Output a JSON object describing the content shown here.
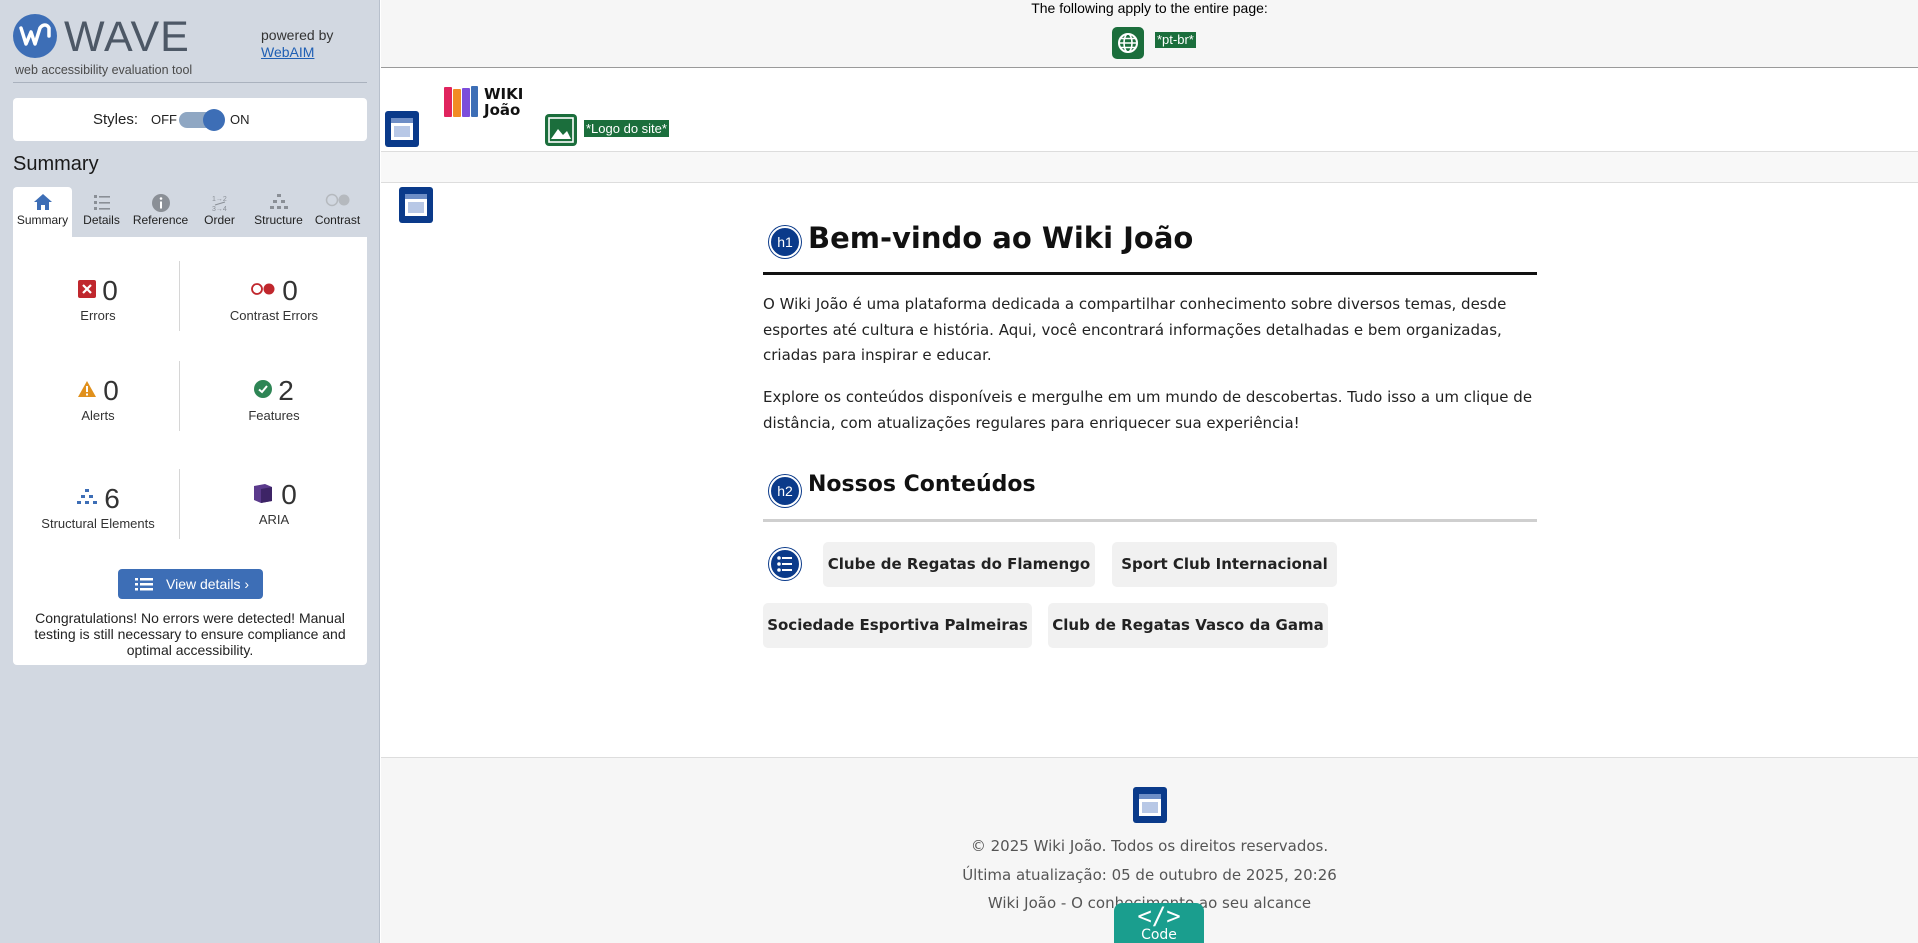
{
  "wave": {
    "title": "WAVE",
    "subtitle": "web accessibility evaluation tool",
    "powered_by": "powered by",
    "webaim_link": "WebAIM",
    "styles_label": "Styles:",
    "styles_off": "OFF",
    "styles_on": "ON",
    "styles_enabled": true,
    "summary_heading": "Summary",
    "tabs": [
      {
        "label": "Summary",
        "icon": "home-icon",
        "active": true
      },
      {
        "label": "Details",
        "icon": "list-icon",
        "active": false
      },
      {
        "label": "Reference",
        "icon": "info-icon",
        "active": false
      },
      {
        "label": "Order",
        "icon": "order-icon",
        "active": false
      },
      {
        "label": "Structure",
        "icon": "structure-icon",
        "active": false
      },
      {
        "label": "Contrast",
        "icon": "contrast-icon",
        "active": false
      }
    ],
    "stats": {
      "errors": {
        "value": "0",
        "label": "Errors"
      },
      "contrast_errors": {
        "value": "0",
        "label": "Contrast Errors"
      },
      "alerts": {
        "value": "0",
        "label": "Alerts"
      },
      "features": {
        "value": "2",
        "label": "Features"
      },
      "structural": {
        "value": "6",
        "label": "Structural Elements"
      },
      "aria": {
        "value": "0",
        "label": "ARIA"
      }
    },
    "view_details": "View details ›",
    "congrats": "Congratulations! No errors were detected! Manual testing is still necessary to ensure compliance and optimal accessibility."
  },
  "page": {
    "lang_notice": "The following apply to the entire page:",
    "lang_tag": "*pt-br*",
    "logo_text_line1": "WIKI",
    "logo_text_line2": "João",
    "logo_alt": "*Logo do site*",
    "h1_badge": "h1",
    "h1": "Bem-vindo ao Wiki João",
    "p1": "O Wiki João é uma plataforma dedicada a compartilhar conhecimento sobre diversos temas, desde esportes até cultura e história. Aqui, você encontrará informações detalhadas e bem organizadas, criadas para inspirar e educar.",
    "p2": "Explore os conteúdos disponíveis e mergulhe em um mundo de descobertas. Tudo isso a um clique de distância, com atualizações regulares para enriquecer sua experiência!",
    "h2_badge": "h2",
    "h2": "Nossos Conteúdos",
    "links": [
      "Clube de Regatas do Flamengo",
      "Sport Club Internacional",
      "Sociedade Esportiva Palmeiras",
      "Club de Regatas Vasco da Gama"
    ],
    "footer": {
      "copyright": "© 2025 Wiki João. Todos os direitos reservados.",
      "updated": "Última atualização: 05 de outubro de 2025, 20:26",
      "tagline": "Wiki João - O conhecimento ao seu alcance"
    },
    "code_button": "Code",
    "code_glyph": "</>"
  },
  "colors": {
    "wave_blue": "#3d6eb6",
    "feature_green": "#1b6e3c",
    "structure_navy": "#0a3a8a",
    "code_teal": "#1a9e8e",
    "error_red": "#c0272d",
    "alert_orange": "#e0901c"
  }
}
